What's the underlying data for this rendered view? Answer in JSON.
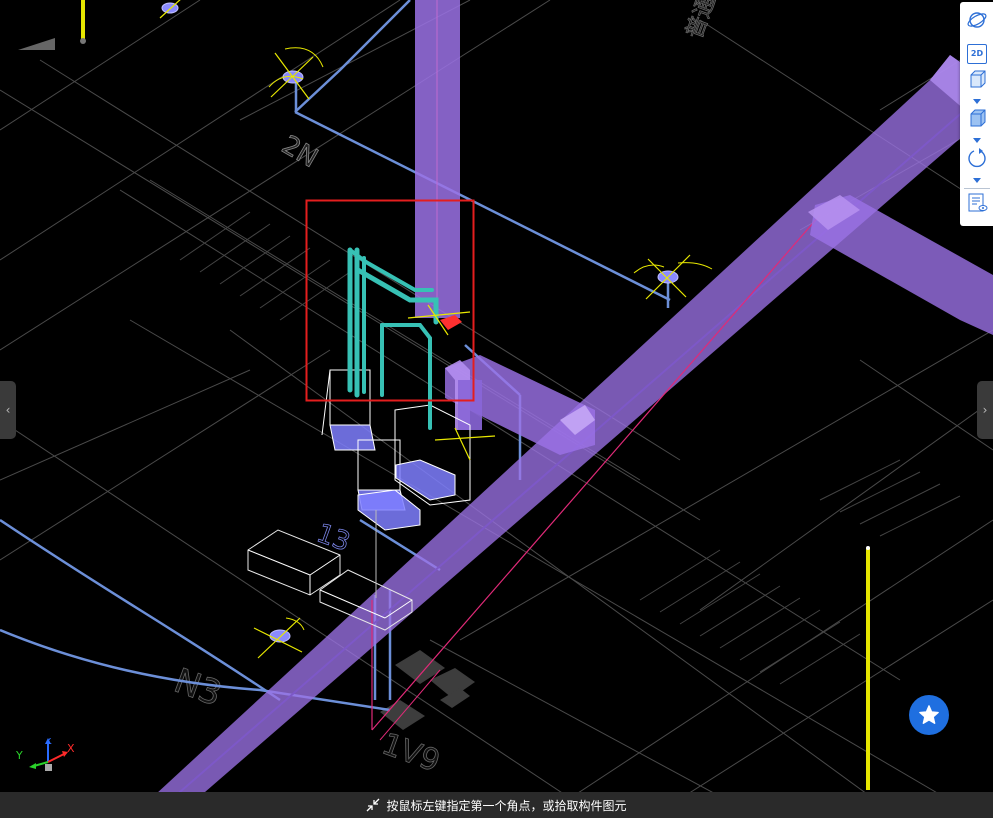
{
  "viewport": {
    "scene_labels": {
      "label_2n": "2N",
      "label_n3": "N3",
      "label_13": "13",
      "label_1v": "1V9",
      "label_top": "普通"
    },
    "selection_box_color": "#e41e1e",
    "colors": {
      "duct": "#9b72e6",
      "pipe": "#6c8fd8",
      "teal_pipe": "#37c1b5",
      "red_line": "#e02a78",
      "yellow_post": "#e6e600",
      "linework": "#4f4f4f"
    }
  },
  "toolbar": {
    "buttons": [
      {
        "name": "orbit-view",
        "icon": "orbit-icon"
      },
      {
        "name": "2d-view",
        "icon": "2d-icon",
        "label": "2D"
      },
      {
        "name": "3d-box-view",
        "icon": "cube-icon"
      },
      {
        "name": "section-box",
        "icon": "cube-solid-icon"
      },
      {
        "name": "rotate",
        "icon": "rotate-icon"
      },
      {
        "name": "property-panel",
        "icon": "list-eye-icon"
      }
    ]
  },
  "axis_gizmo": {
    "x": "X",
    "y": "Y",
    "z": "Z"
  },
  "status_bar": {
    "message": "按鼠标左键指定第一个角点，或拾取构件图元"
  },
  "fab": {
    "icon": "star-icon"
  },
  "handles": {
    "left": "‹",
    "right": "›"
  }
}
